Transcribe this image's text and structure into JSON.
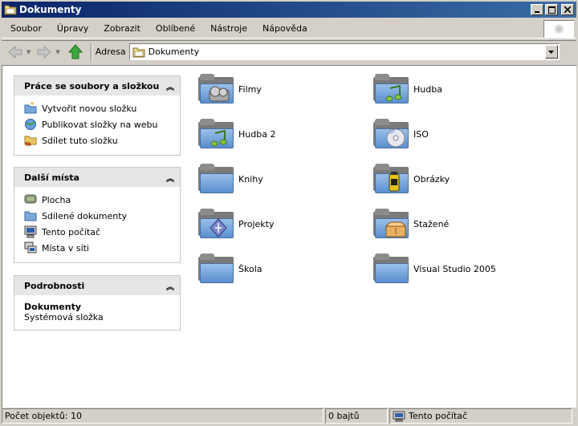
{
  "window": {
    "title": "Dokumenty"
  },
  "menu": [
    "Soubor",
    "Úpravy",
    "Zobrazit",
    "Oblíbené",
    "Nástroje",
    "Nápověda"
  ],
  "address": {
    "label": "Adresa",
    "value": "Dokumenty"
  },
  "panels": {
    "tasks": {
      "title": "Práce se soubory a složkou",
      "items": [
        "Vytvořit novou složku",
        "Publikovat složky na webu",
        "Sdílet tuto složku"
      ]
    },
    "places": {
      "title": "Další místa",
      "items": [
        "Plocha",
        "Sdílené dokumenty",
        "Tento počítač",
        "Místa v síti"
      ]
    },
    "details": {
      "title": "Podrobnosti",
      "name": "Dokumenty",
      "type": "Systémová složka"
    }
  },
  "folders": [
    "Filmy",
    "Hudba",
    "Hudba 2",
    "ISO",
    "Knihy",
    "Obrázky",
    "Projekty",
    "Stažené",
    "Škola",
    "Visual Studio 2005"
  ],
  "status": {
    "count": "Počet objektů: 10",
    "size": "0 bajtů",
    "location": "Tento počítač"
  },
  "colors": {
    "titlebar_start": "#0a246a",
    "titlebar_end": "#3a6ea5",
    "face": "#d4d0c8",
    "panel_head": "#e6e6e6"
  }
}
